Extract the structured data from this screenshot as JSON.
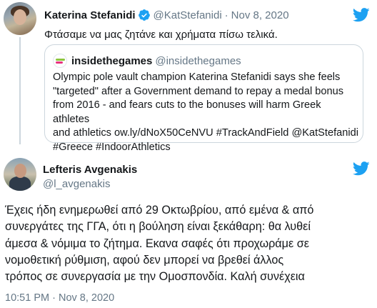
{
  "quoted_reply": {
    "display_name": "Katerina Stefanidi",
    "handle": "@KatStefanidi",
    "separator": "·",
    "date": "Nov 8, 2020",
    "text": "Φτάσαμε να μας ζητάνε και χρήματα πίσω τελικά.",
    "quote": {
      "display_name": "insidethegames",
      "handle": "@insidethegames",
      "lines": [
        "Olympic pole vault champion Katerina Stefanidi says she feels",
        "\"targeted\" after a Government demand to repay a medal bonus",
        "from 2016 - and fears cuts to the bonuses will harm Greek athletes",
        "and athletics ow.ly/dNoX50CeNVU #TrackAndField @KatStefanidi",
        "#Greece #IndoorAthletics"
      ]
    }
  },
  "main_tweet": {
    "display_name": "Lefteris Avgenakis",
    "handle": "@l_avgenakis",
    "lines": [
      "Έχεις ήδη ενημερωθεί από 29 Οκτωβρίου, από εμένα & από",
      "συνεργάτες της ΓΓΑ, ότι η βούληση είναι ξεκάθαρη: θα λυθεί",
      "άμεσα & νόμιμα το ζήτημα. Εκανα σαφές ότι προχωράμε σε",
      "νομοθετική ρύθμιση, αφού δεν μπορεί να βρεθεί άλλος",
      "τρόπος σε συνεργασία με την Ομοσπονδία. Καλή συνέχεια"
    ],
    "time": "10:51 PM",
    "separator": "·",
    "date": "Nov 8, 2020"
  },
  "icons": {
    "verified": "verified-badge-icon",
    "twitter": "twitter-bird-icon"
  },
  "colors": {
    "twitter_blue": "#1da1f2",
    "text": "#14171a",
    "secondary": "#657786",
    "border": "#ccd6dd"
  }
}
